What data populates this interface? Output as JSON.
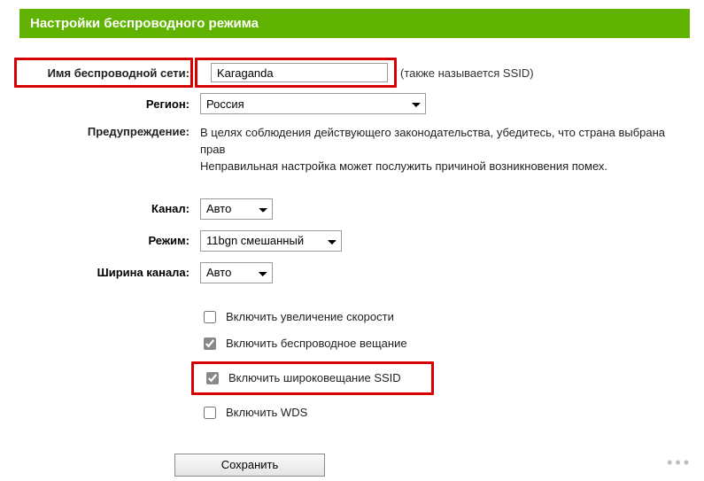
{
  "header": {
    "title": "Настройки беспроводного режима"
  },
  "form": {
    "ssid_label": "Имя беспроводной сети:",
    "ssid_value": "Karaganda",
    "ssid_hint": "(также называется SSID)",
    "region_label": "Регион:",
    "region_value": "Россия",
    "warn_label": "Предупреждение:",
    "warn_text": "В целях соблюдения действующего законодательства, убедитесь, что страна выбрана прав\nНеправильная настройка может послужить причиной возникновения помех.",
    "channel_label": "Канал:",
    "channel_value": "Авто",
    "mode_label": "Режим:",
    "mode_value": "11bgn смешанный",
    "width_label": "Ширина канала:",
    "width_value": "Авто"
  },
  "checkboxes": {
    "speed_boost": {
      "label": "Включить увеличение скорости",
      "checked": false
    },
    "broadcast": {
      "label": "Включить беспроводное вещание",
      "checked": true
    },
    "ssid_bc": {
      "label": "Включить широковещание SSID",
      "checked": true
    },
    "wds": {
      "label": "Включить WDS",
      "checked": false
    }
  },
  "buttons": {
    "save": "Сохранить"
  }
}
